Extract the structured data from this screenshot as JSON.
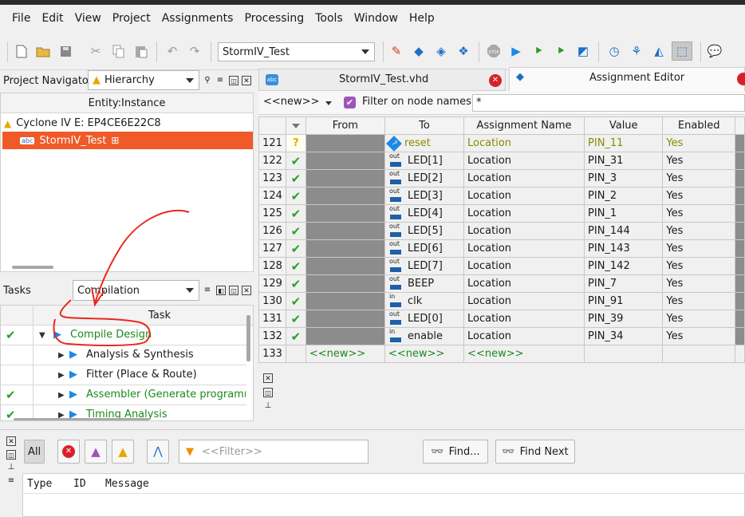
{
  "menu": [
    "File",
    "Edit",
    "View",
    "Project",
    "Assignments",
    "Processing",
    "Tools",
    "Window",
    "Help"
  ],
  "toolbar": {
    "revision": "StormIV_Test",
    "icons": [
      "new-file-icon",
      "open-folder-icon",
      "save-icon",
      "cut-icon",
      "copy-icon",
      "paste-icon",
      "undo-icon",
      "redo-icon",
      "settings-edit-icon",
      "analysis-icon",
      "elaboration-icon",
      "netlist-icon",
      "stop-icon",
      "start-compile-icon",
      "analysis-synthesis-icon",
      "fitter-icon",
      "assembler-icon",
      "timing-icon",
      "rtl-viewer-icon",
      "pin-planner-icon",
      "chip-planner-icon",
      "help-icon"
    ]
  },
  "navigator": {
    "label": "Project Navigator",
    "view": "Hierarchy",
    "header": "Entity:Instance",
    "device": "Cyclone IV E: EP4CE6E22C8",
    "top_entity": "StormIV_Test"
  },
  "tasks": {
    "label": "Tasks",
    "flow": "Compilation",
    "header": "Task",
    "items": [
      {
        "label": "Compile Design",
        "status": "done",
        "expanded": true,
        "level": 0,
        "green": true
      },
      {
        "label": "Analysis & Synthesis",
        "status": "",
        "expanded": false,
        "level": 1,
        "green": false
      },
      {
        "label": "Fitter (Place & Route)",
        "status": "",
        "expanded": false,
        "level": 1,
        "green": false
      },
      {
        "label": "Assembler (Generate programmin",
        "status": "done",
        "expanded": false,
        "level": 1,
        "green": true
      },
      {
        "label": "Timing Analysis",
        "status": "done",
        "expanded": false,
        "level": 1,
        "green": true
      }
    ]
  },
  "tabs": [
    {
      "label": "StormIV_Test.vhd",
      "active": false
    },
    {
      "label": "Assignment Editor",
      "active": true
    }
  ],
  "editor": {
    "new_combo": "<<new>>",
    "filter_label": "Filter on node names:",
    "filter_value": "*",
    "columns": [
      "From",
      "To",
      "Assignment Name",
      "Value",
      "Enabled"
    ],
    "rows": [
      {
        "num": "121",
        "status": "?",
        "dir": "in-out",
        "to": "reset",
        "name": "Location",
        "value": "PIN_11",
        "enabled": "Yes",
        "olive": true
      },
      {
        "num": "122",
        "status": "ok",
        "dir": "out",
        "to": "LED[1]",
        "name": "Location",
        "value": "PIN_31",
        "enabled": "Yes",
        "olive": false
      },
      {
        "num": "123",
        "status": "ok",
        "dir": "out",
        "to": "LED[2]",
        "name": "Location",
        "value": "PIN_3",
        "enabled": "Yes",
        "olive": false
      },
      {
        "num": "124",
        "status": "ok",
        "dir": "out",
        "to": "LED[3]",
        "name": "Location",
        "value": "PIN_2",
        "enabled": "Yes",
        "olive": false
      },
      {
        "num": "125",
        "status": "ok",
        "dir": "out",
        "to": "LED[4]",
        "name": "Location",
        "value": "PIN_1",
        "enabled": "Yes",
        "olive": false
      },
      {
        "num": "126",
        "status": "ok",
        "dir": "out",
        "to": "LED[5]",
        "name": "Location",
        "value": "PIN_144",
        "enabled": "Yes",
        "olive": false
      },
      {
        "num": "127",
        "status": "ok",
        "dir": "out",
        "to": "LED[6]",
        "name": "Location",
        "value": "PIN_143",
        "enabled": "Yes",
        "olive": false
      },
      {
        "num": "128",
        "status": "ok",
        "dir": "out",
        "to": "LED[7]",
        "name": "Location",
        "value": "PIN_142",
        "enabled": "Yes",
        "olive": false
      },
      {
        "num": "129",
        "status": "ok",
        "dir": "out",
        "to": "BEEP",
        "name": "Location",
        "value": "PIN_7",
        "enabled": "Yes",
        "olive": false
      },
      {
        "num": "130",
        "status": "ok",
        "dir": "in",
        "to": "clk",
        "name": "Location",
        "value": "PIN_91",
        "enabled": "Yes",
        "olive": false
      },
      {
        "num": "131",
        "status": "ok",
        "dir": "out",
        "to": "LED[0]",
        "name": "Location",
        "value": "PIN_39",
        "enabled": "Yes",
        "olive": false
      },
      {
        "num": "132",
        "status": "ok",
        "dir": "in",
        "to": "enable",
        "name": "Location",
        "value": "PIN_34",
        "enabled": "Yes",
        "olive": false
      }
    ],
    "new_row": {
      "num": "133",
      "from": "<<new>>",
      "to": "<<new>>",
      "name": "<<new>>"
    }
  },
  "messages": {
    "all": "All",
    "filter_placeholder": "<<Filter>>",
    "find": "Find...",
    "find_next": "Find Next",
    "columns": [
      "Type",
      "ID",
      "Message"
    ]
  },
  "colors": {
    "selection": "#f05a28",
    "green": "#1a8a1a",
    "olive": "#8a8a00",
    "accent": "#1e88e5",
    "annotation": "#e8281e"
  }
}
